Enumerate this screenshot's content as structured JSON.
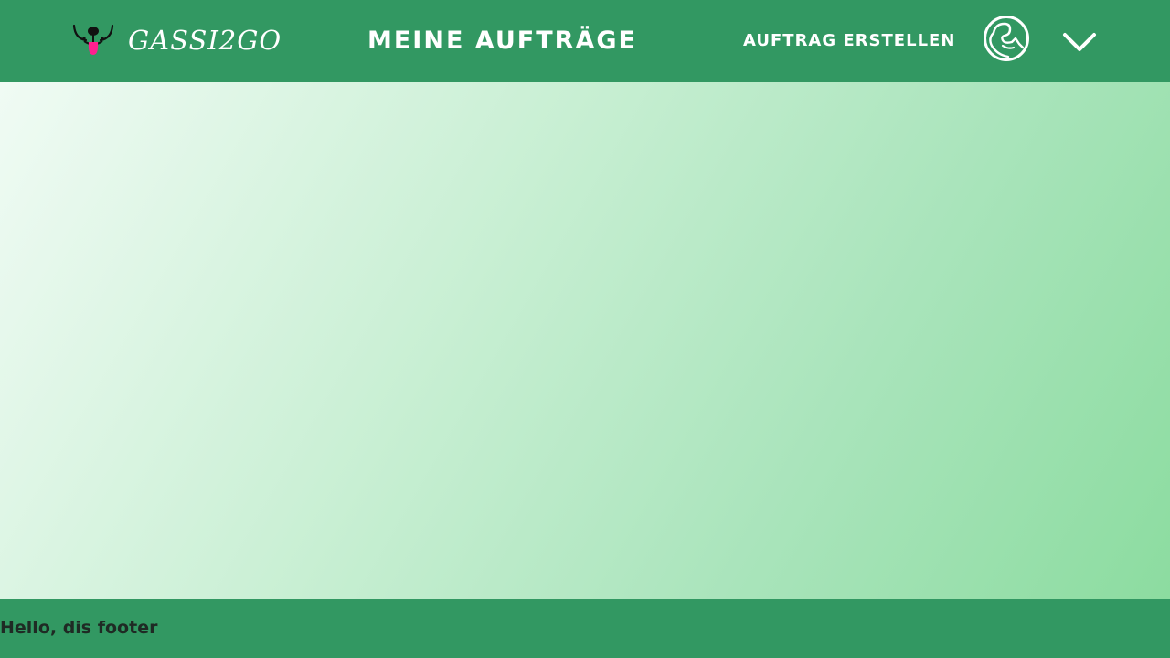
{
  "header": {
    "brand": "GASSI2GO",
    "page_title": "MEINE AUFTRÄGE",
    "create_link": "AUFTRAG ERSTELLEN",
    "icons": {
      "logo": "dog-face-logo-icon",
      "profile": "dog-profile-avatar-icon",
      "menu": "chevron-down-icon"
    }
  },
  "footer": {
    "text": "Hello, dis footer"
  },
  "colors": {
    "primary_green": "#329862",
    "gradient_start": "#f0fbf4",
    "gradient_end": "#8cdca0",
    "footer_text": "#1f2a24",
    "logo_tongue": "#ff1f8f"
  }
}
